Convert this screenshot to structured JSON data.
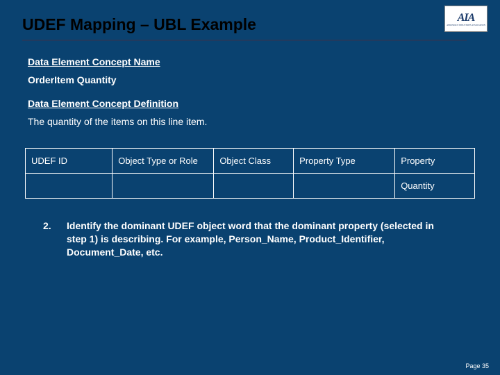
{
  "header": {
    "title": "UDEF Mapping – UBL Example",
    "logo_main": "AIA",
    "logo_sub": "AEROSPACE INDUSTRIES ASSOCIATION"
  },
  "section": {
    "name_label": "Data Element Concept Name",
    "name_value": "OrderItem Quantity",
    "def_label": "Data Element Concept Definition",
    "def_value": "The quantity of the items on this line item."
  },
  "table": {
    "headers": {
      "udef_id": "UDEF ID",
      "object_type": "Object Type or Role",
      "object_class": "Object Class",
      "property_type": "Property Type",
      "property": "Property"
    },
    "row": {
      "udef_id": "",
      "object_type": "",
      "object_class": "",
      "property_type": "",
      "property": "Quantity"
    }
  },
  "step": {
    "number": "2.",
    "text": "Identify the dominant UDEF object word that the dominant property (selected in step 1) is describing. For example, Person_Name, Product_Identifier, Document_Date, etc."
  },
  "footer": {
    "page": "Page 35"
  }
}
